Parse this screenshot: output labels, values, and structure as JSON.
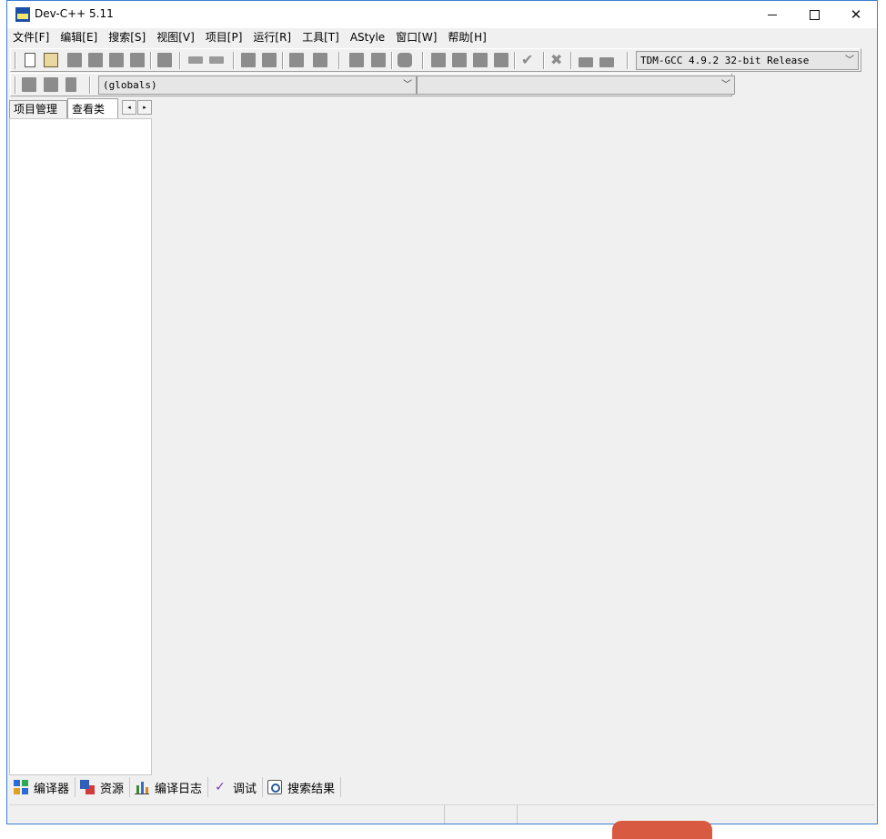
{
  "window": {
    "title": "Dev-C++ 5.11",
    "minimize_glyph": "—",
    "maximize_glyph": "☐",
    "close_glyph": "✕"
  },
  "menu": {
    "items": [
      "文件[F]",
      "编辑[E]",
      "搜索[S]",
      "视图[V]",
      "项目[P]",
      "运行[R]",
      "工具[T]",
      "AStyle",
      "窗口[W]",
      "帮助[H]"
    ]
  },
  "toolbar": {
    "compiler_select": "TDM-GCC 4.9.2 32-bit Release",
    "scope_select": "(globals)",
    "function_select": ""
  },
  "left_panel": {
    "tabs": [
      "项目管理",
      "查看类"
    ],
    "active_tab": "查看类",
    "scroll_left": "◂",
    "scroll_right": "▸"
  },
  "bottom_tabs": [
    {
      "label": "编译器",
      "icon": "compiler-icon"
    },
    {
      "label": "资源",
      "icon": "resources-icon"
    },
    {
      "label": "编译日志",
      "icon": "compile-log-icon"
    },
    {
      "label": "调试",
      "icon": "debug-icon"
    },
    {
      "label": "搜索结果",
      "icon": "search-results-icon"
    }
  ]
}
